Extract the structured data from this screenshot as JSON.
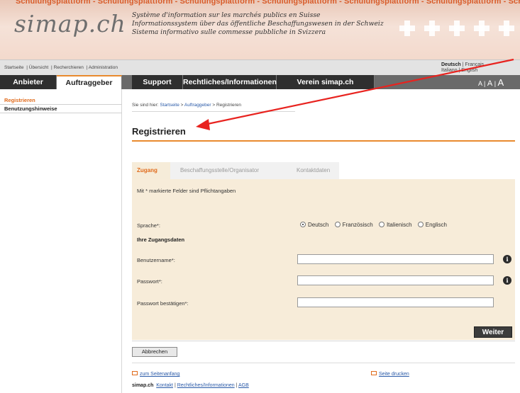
{
  "header": {
    "watermark": "Schulungsplattform - Schulungsplattform - Schulungsplattform - Schulungsplattform - Schulungsplattform - Schulungsplattform - Schulungsplattform",
    "logo": "simap.ch",
    "tagline_fr": "Système d'information sur les marchés publics en Suisse",
    "tagline_de": "Informationssystem über das öffentliche Beschaffungswesen in der Schweiz",
    "tagline_it": "Sistema informativo sulle commesse pubbliche in Svizzera"
  },
  "utility": {
    "startseite": "Startseite",
    "uebersicht": "Übersicht",
    "recherchieren": "Recherchieren",
    "administration": "Administration",
    "lang_de": "Deutsch",
    "lang_fr": "Français",
    "lang_it": "Italiano",
    "lang_en": "English"
  },
  "nav": {
    "anbieter": "Anbieter",
    "auftraggeber": "Auftraggeber",
    "support": "Support",
    "rechtliches": "Rechtliches/Informationen",
    "verein": "Verein simap.ch",
    "fontsize_small": "A",
    "fontsize_medium": "A",
    "fontsize_large": "A"
  },
  "sidebar": {
    "items": [
      {
        "label": "Registrieren"
      },
      {
        "label": "Benutzungshinweise"
      }
    ]
  },
  "breadcrumb": {
    "prefix": "Sie sind hier:",
    "crumb1": "Startseite",
    "crumb2": "Auftraggeber",
    "current": "Registrieren"
  },
  "page": {
    "title": "Registrieren"
  },
  "tabs": [
    {
      "label": "Zugang"
    },
    {
      "label": "Beschaffungsstelle/Organisator"
    },
    {
      "label": "Kontaktdaten"
    }
  ],
  "form": {
    "required_note": "Mit * markierte Felder sind Pflichtangaben",
    "sprache_label": "Sprache*:",
    "languages": [
      "Deutsch",
      "Französisch",
      "Italienisch",
      "Englisch"
    ],
    "selected_language": "Deutsch",
    "section_heading": "Ihre Zugangsdaten",
    "username_label": "Benutzername*:",
    "username_value": "",
    "password_label": "Passwort*:",
    "password_value": "",
    "confirm_label": "Passwort bestätigen*:",
    "confirm_value": "",
    "info_glyph": "i",
    "next_button": "Weiter",
    "cancel_button": "Abbrechen"
  },
  "footer": {
    "top_link": "zum Seitenanfang",
    "print_link": "Seite drucken",
    "brand": "simap.ch",
    "kontakt": "Kontakt",
    "rechtliches": "Rechtliches/Informationen",
    "agb": "AGB"
  },
  "colors": {
    "accent": "#e98a2e",
    "annotation": "#e8231f",
    "form_bg": "#f7ecd9",
    "nav_dark": "#2f2f2f"
  }
}
